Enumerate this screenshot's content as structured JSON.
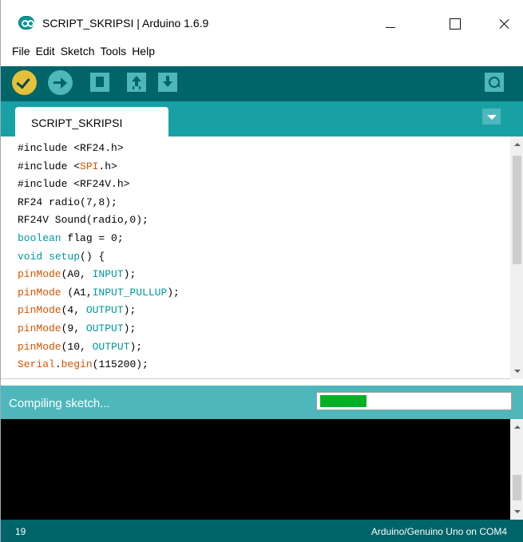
{
  "window": {
    "title": "SCRIPT_SKRIPSI | Arduino 1.6.9"
  },
  "menu": [
    "File",
    "Edit",
    "Sketch",
    "Tools",
    "Help"
  ],
  "toolbar": {
    "buttons": [
      "verify-icon",
      "upload-icon",
      "new-icon",
      "open-icon",
      "save-icon",
      "serial-monitor-icon"
    ]
  },
  "tab": {
    "label": "SCRIPT_SKRIPSI"
  },
  "editor": {
    "lines": [
      [
        {
          "t": "#include <RF24.h>",
          "c": "plain"
        }
      ],
      [
        {
          "t": "#include <",
          "c": "plain"
        },
        {
          "t": "SPI",
          "c": "fn"
        },
        {
          "t": ".h>",
          "c": "plain"
        }
      ],
      [
        {
          "t": "#include <RF24V.h>",
          "c": "plain"
        }
      ],
      [
        {
          "t": "RF24 radio(7,8);",
          "c": "plain"
        }
      ],
      [
        {
          "t": "RF24V Sound(radio,0);",
          "c": "plain"
        }
      ],
      [
        {
          "t": "boolean",
          "c": "kw"
        },
        {
          "t": " flag = 0;",
          "c": "plain"
        }
      ],
      [
        {
          "t": "void",
          "c": "kw"
        },
        {
          "t": " ",
          "c": "plain"
        },
        {
          "t": "setup",
          "c": "kw"
        },
        {
          "t": "() {",
          "c": "plain"
        }
      ],
      [
        {
          "t": "pinMode",
          "c": "fn"
        },
        {
          "t": "(A0, ",
          "c": "plain"
        },
        {
          "t": "INPUT",
          "c": "const"
        },
        {
          "t": ");",
          "c": "plain"
        }
      ],
      [
        {
          "t": "pinMode",
          "c": "fn"
        },
        {
          "t": " (A1,",
          "c": "plain"
        },
        {
          "t": "INPUT_PULLUP",
          "c": "const"
        },
        {
          "t": ");",
          "c": "plain"
        }
      ],
      [
        {
          "t": "pinMode",
          "c": "fn"
        },
        {
          "t": "(4, ",
          "c": "plain"
        },
        {
          "t": "OUTPUT",
          "c": "const"
        },
        {
          "t": ");",
          "c": "plain"
        }
      ],
      [
        {
          "t": "pinMode",
          "c": "fn"
        },
        {
          "t": "(9, ",
          "c": "plain"
        },
        {
          "t": "OUTPUT",
          "c": "const"
        },
        {
          "t": ");",
          "c": "plain"
        }
      ],
      [
        {
          "t": "pinMode",
          "c": "fn"
        },
        {
          "t": "(10, ",
          "c": "plain"
        },
        {
          "t": "OUTPUT",
          "c": "const"
        },
        {
          "t": ");",
          "c": "plain"
        }
      ],
      [
        {
          "t": "Serial",
          "c": "fn"
        },
        {
          "t": ".",
          "c": "plain"
        },
        {
          "t": "begin",
          "c": "fn"
        },
        {
          "t": "(115200);",
          "c": "plain"
        }
      ]
    ]
  },
  "status": {
    "message": "Compiling sketch...",
    "progress": 0.24
  },
  "footer": {
    "line_number": "19",
    "board": "Arduino/Genuino Uno on COM4"
  },
  "colors": {
    "toolbar": "#006468",
    "tabstrip": "#17a1a5",
    "status": "#4db7bb",
    "verify": "#e5c13b",
    "progress": "#06b025"
  }
}
